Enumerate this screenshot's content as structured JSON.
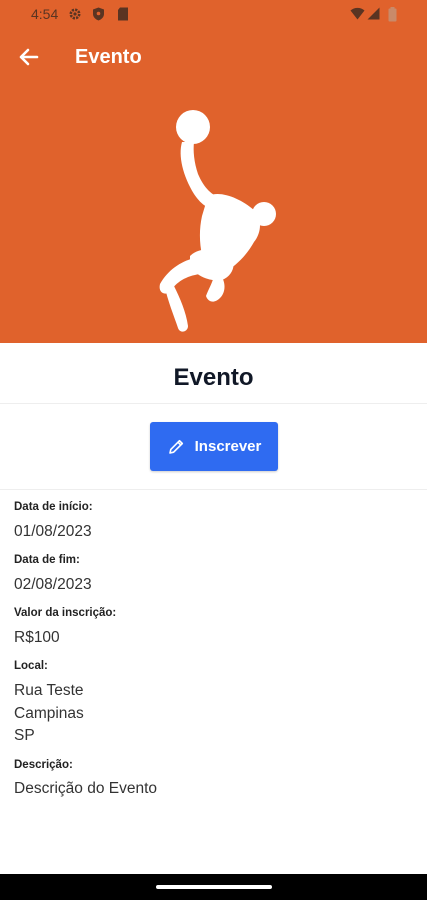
{
  "status_bar": {
    "time": "4:54",
    "icons": [
      "gear-icon",
      "shield-icon",
      "sd-card-icon",
      "wifi-icon",
      "signal-icon",
      "battery-icon"
    ]
  },
  "app_bar": {
    "title": "Evento",
    "back_icon": "arrow-left-icon"
  },
  "hero": {
    "image": "basketball-player-silhouette",
    "background_color": "#E0622C"
  },
  "event": {
    "title": "Evento"
  },
  "actions": {
    "subscribe_label": "Inscrever",
    "subscribe_icon": "pencil-icon",
    "button_color": "#2F6BF1"
  },
  "details": {
    "start_label": "Data de início:",
    "start_value": "01/08/2023",
    "end_label": "Data de fim:",
    "end_value": "02/08/2023",
    "price_label": "Valor da inscrição:",
    "price_value": "R$100",
    "location_label": "Local:",
    "location_street": "Rua Teste",
    "location_city": "Campinas",
    "location_state": "SP",
    "description_label": "Descrição:",
    "description_value": "Descrição do Evento"
  }
}
